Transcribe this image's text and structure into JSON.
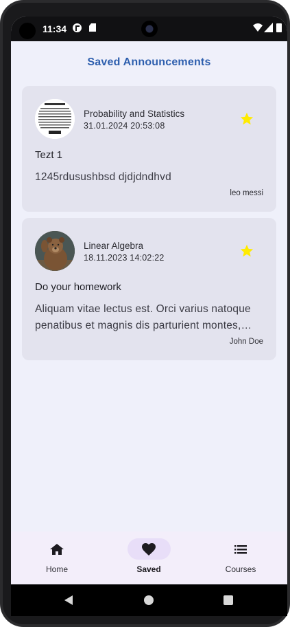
{
  "status_bar": {
    "time": "11:34",
    "icons": [
      "app-notification-icon",
      "sd-card-icon",
      "wifi-icon",
      "signal-icon",
      "battery-icon"
    ]
  },
  "header": {
    "title": "Saved Announcements"
  },
  "announcements": [
    {
      "course": "Probability and Statistics",
      "datetime": "31.01.2024 20:53:08",
      "title": "Tezt 1",
      "body": "1245rdusushbsd djdjdndhvd",
      "author": "leo messi",
      "saved": true,
      "avatar": "document-thumbnail"
    },
    {
      "course": "Linear Algebra",
      "datetime": "18.11.2023 14:02:22",
      "title": "Do your homework",
      "body": "Aliquam vitae lectus est. Orci varius natoque penatibus et magnis dis parturient montes, nascetur ridiculus mus.",
      "author": "John Doe",
      "saved": true,
      "avatar": "bear-photo"
    }
  ],
  "bottom_nav": {
    "items": [
      {
        "label": "Home",
        "icon": "home-icon",
        "active": false
      },
      {
        "label": "Saved",
        "icon": "heart-icon",
        "active": true
      },
      {
        "label": "Courses",
        "icon": "list-icon",
        "active": false
      }
    ]
  },
  "colors": {
    "title": "#2e5fae",
    "background": "#eff0fa",
    "card": "#e3e3ee",
    "star": "#ffeb00",
    "nav_pill": "#e8def8"
  }
}
